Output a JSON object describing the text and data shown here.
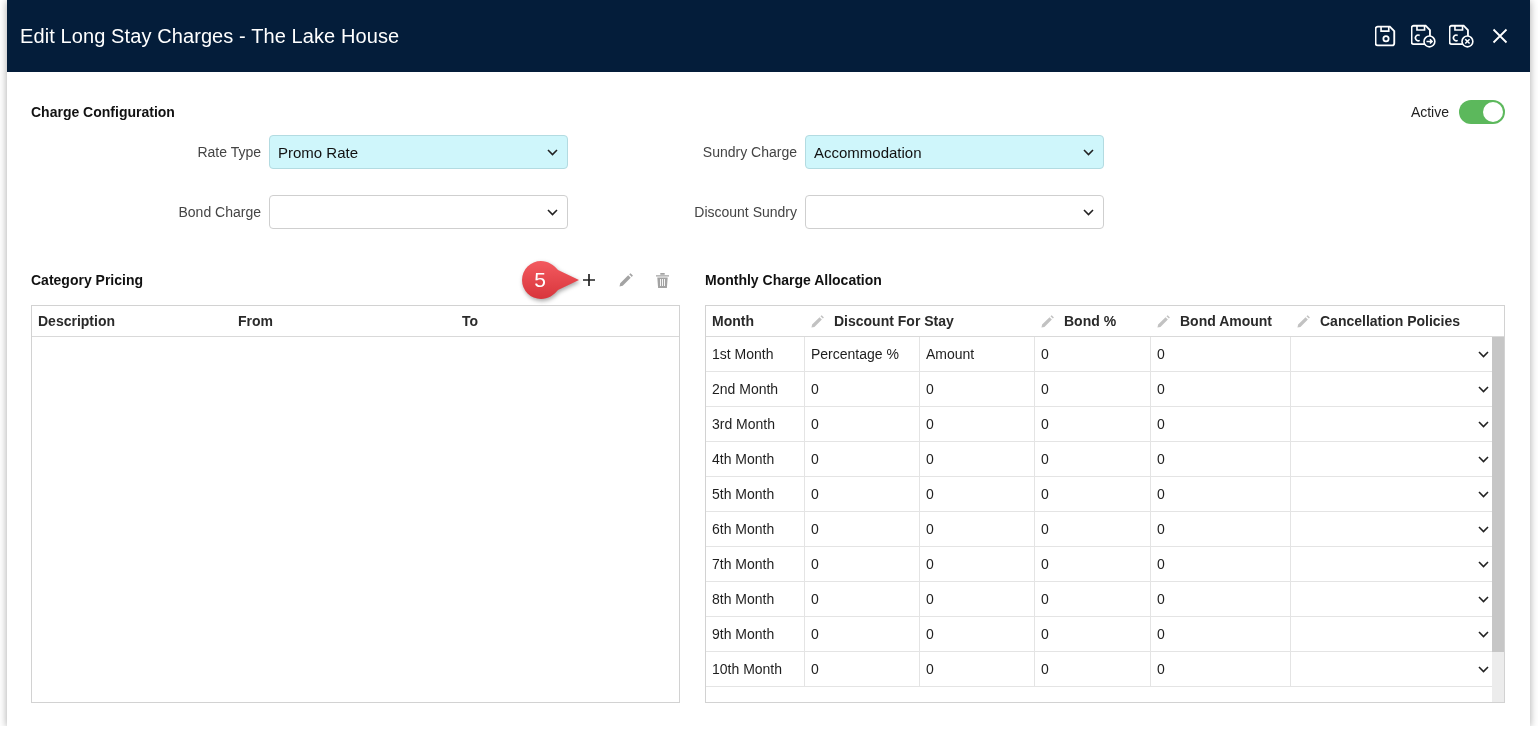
{
  "window": {
    "title": "Edit Long Stay Charges - The Lake House"
  },
  "charge_configuration": {
    "title": "Charge Configuration",
    "active": {
      "label": "Active",
      "on": true
    },
    "fields": [
      {
        "label": "Rate Type",
        "value": "Promo Rate",
        "highlighted": true
      },
      {
        "label": "Sundry Charge",
        "value": "Accommodation",
        "highlighted": true
      },
      {
        "label": "Bond Charge",
        "highlighted": false
      },
      {
        "label": "Discount Sundry",
        "highlighted": false
      }
    ]
  },
  "category_pricing": {
    "title": "Category Pricing",
    "callout": "5",
    "actions": [
      {
        "kind": "add",
        "disabled": false
      },
      {
        "kind": "edit",
        "disabled": true
      },
      {
        "kind": "delete",
        "disabled": true
      }
    ],
    "columns": [
      "Description",
      "From",
      "To"
    ]
  },
  "monthly_charge_allocation": {
    "title": "Monthly Charge Allocation",
    "columns": [
      {
        "label": "Month",
        "editable": false
      },
      {
        "label": "Discount For Stay",
        "editable": true
      },
      {
        "label": "Bond %",
        "editable": true
      },
      {
        "label": "Bond Amount",
        "editable": true
      },
      {
        "label": "Cancellation Policies",
        "editable": true
      }
    ],
    "rows": [
      {
        "month": "1st Month",
        "cells": [
          "Percentage %",
          "Amount",
          "0",
          "0"
        ]
      },
      {
        "month": "2nd Month",
        "cells": [
          "0",
          "0",
          "0",
          "0"
        ]
      },
      {
        "month": "3rd Month",
        "cells": [
          "0",
          "0",
          "0",
          "0"
        ]
      },
      {
        "month": "4th Month",
        "cells": [
          "0",
          "0",
          "0",
          "0"
        ]
      },
      {
        "month": "5th Month",
        "cells": [
          "0",
          "0",
          "0",
          "0"
        ]
      },
      {
        "month": "6th Month",
        "cells": [
          "0",
          "0",
          "0",
          "0"
        ]
      },
      {
        "month": "7th Month",
        "cells": [
          "0",
          "0",
          "0",
          "0"
        ]
      },
      {
        "month": "8th Month",
        "cells": [
          "0",
          "0",
          "0",
          "0"
        ]
      },
      {
        "month": "9th Month",
        "cells": [
          "0",
          "0",
          "0",
          "0"
        ]
      },
      {
        "month": "10th Month",
        "cells": [
          "0",
          "0",
          "0",
          "0"
        ]
      }
    ]
  }
}
